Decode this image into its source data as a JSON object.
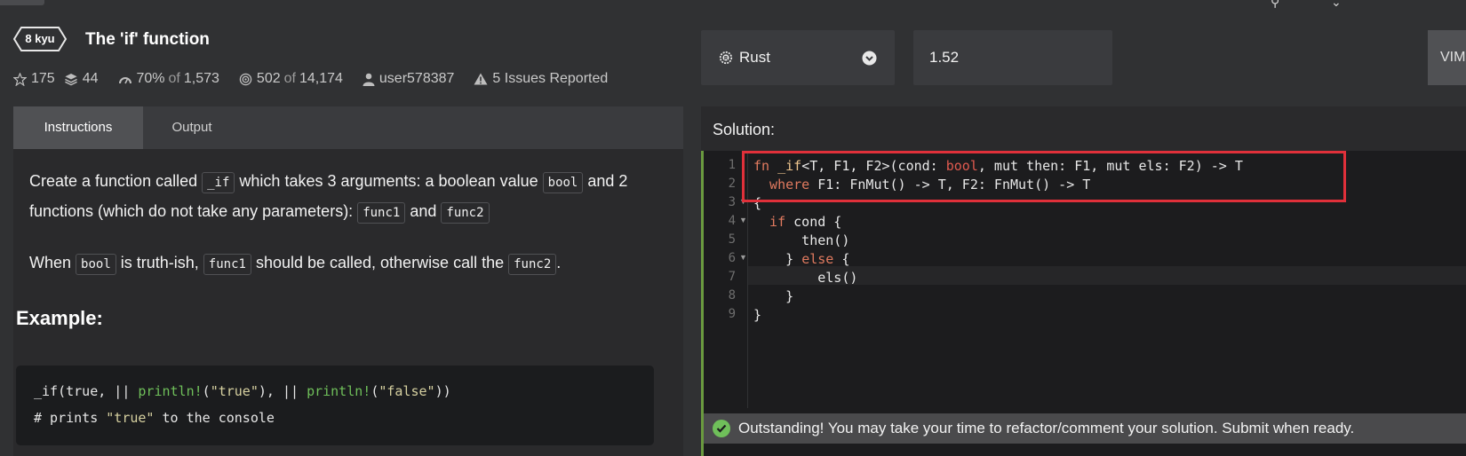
{
  "kata": {
    "rank": "8 kyu",
    "title": "The 'if' function",
    "stars": "175",
    "collections": "44",
    "satisfaction": "70%",
    "satisfaction_of_label": "of",
    "satisfaction_votes": "1,573",
    "completed": "502",
    "completed_of_label": "of",
    "completed_total": "14,174",
    "author": "user578387",
    "issues": "5 Issues Reported"
  },
  "tabs": {
    "instructions": "Instructions",
    "output": "Output"
  },
  "description": {
    "p1_a": "Create a function called ",
    "p1_code1": "_if",
    "p1_b": " which takes 3 arguments: a boolean value ",
    "p1_code2": "bool",
    "p1_c": " and 2 functions (which do not take any parameters): ",
    "p1_code3": "func1",
    "p1_d": " and ",
    "p1_code4": "func2",
    "p2_a": "When ",
    "p2_code1": "bool",
    "p2_b": " is truth-ish, ",
    "p2_code2": "func1",
    "p2_c": " should be called, otherwise call the ",
    "p2_code3": "func2",
    "p2_d": ".",
    "example_heading": "Example:"
  },
  "example_code": {
    "l1_a": "_if(true, || ",
    "l1_b": "println!",
    "l1_c": "(",
    "l1_d": "\"true\"",
    "l1_e": "), || ",
    "l1_f": "println!",
    "l1_g": "(",
    "l1_h": "\"false\"",
    "l1_i": "))",
    "l2_a": "# prints ",
    "l2_b": "\"true\"",
    "l2_c": " to the console"
  },
  "toolbar": {
    "language": "Rust",
    "version": "1.52",
    "vim": "VIM"
  },
  "solution": {
    "label": "Solution:",
    "line_numbers": [
      "1",
      "2",
      "3",
      "4",
      "5",
      "6",
      "7",
      "8",
      "9"
    ],
    "l1_fn": "fn ",
    "l1_name": "_if",
    "l1_rest1": "<T, F1, F2>(cond: ",
    "l1_bool": "bool",
    "l1_rest2": ", mut then: F1, mut els: F2) -> T",
    "l2_where": "  where",
    "l2_rest": " F1: FnMut() -> T, F2: FnMut() -> T",
    "l3": "{",
    "l4_a": "  if",
    "l4_b": " cond {",
    "l5": "      then()",
    "l6_a": "    } ",
    "l6_b": "else",
    "l6_c": " {",
    "l7": "        els()",
    "l8": "    }",
    "l9": "}",
    "success_message": "Outstanding! You may take your time to refactor/comment your solution. Submit when ready."
  },
  "colors": {
    "accent_green": "#6fbf5a",
    "highlight_red": "#e0303a"
  }
}
